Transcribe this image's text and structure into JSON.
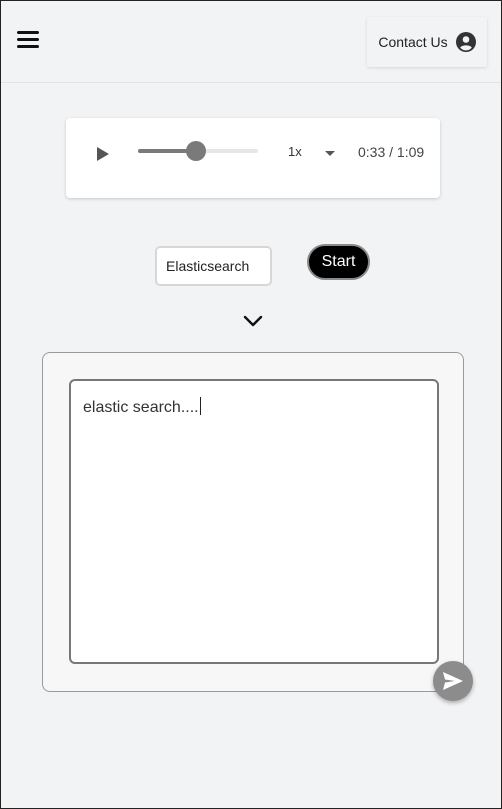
{
  "header": {
    "contact_label": "Contact Us",
    "menu_icon": "hamburger-menu-icon",
    "user_icon": "user-circle-icon"
  },
  "audio_player": {
    "play_icon": "play-icon",
    "progress_fraction": 0.48,
    "speed_label": "1x",
    "time_label": "0:33 / 1:09"
  },
  "search": {
    "value": "Elasticsearch",
    "start_label": "Start"
  },
  "expand_icon": "chevron-down-icon",
  "editor": {
    "text": "elastic search...."
  },
  "send_icon": "send-icon",
  "colors": {
    "background": "#f2f3f5",
    "start_button": "#000000",
    "slider": "#7a7a7a",
    "send_button": "#8c8c8c"
  }
}
